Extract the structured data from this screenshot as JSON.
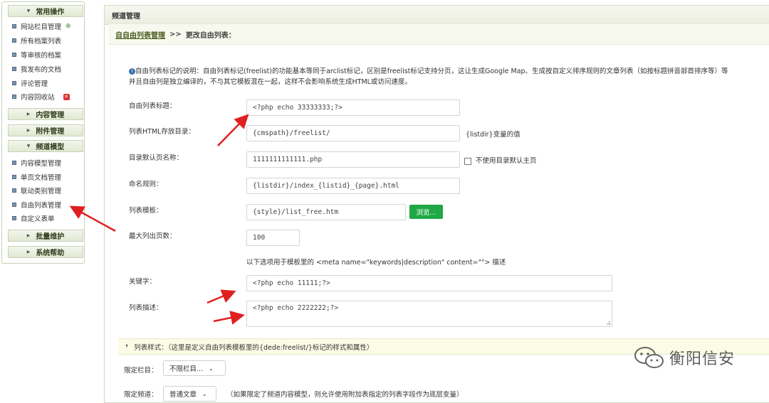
{
  "sidebar": {
    "sections": [
      {
        "label": "常用操作"
      },
      {
        "label": "内容管理"
      },
      {
        "label": "附件管理"
      },
      {
        "label": "频道模型"
      },
      {
        "label": "批量维护"
      },
      {
        "label": "系统帮助"
      }
    ],
    "common_items": [
      "网站栏目管理",
      "所有档案列表",
      "等审核的档案",
      "我发布的文档",
      "评论管理",
      "内容回收站"
    ],
    "channel_items": [
      "内容模型管理",
      "单页文档管理",
      "联动类别管理",
      "自由列表管理",
      "自定义表单"
    ]
  },
  "main": {
    "title": "频道管理",
    "breadcrumb": {
      "link": "自自由列表管理",
      "sep": ">>",
      "current": "更改自由列表："
    },
    "intro_line1": "自由列表标记的说明：自由列表标记(freelist)的功能基本等同于arclist标记，区别是freelist标记支持分页，这让生成Google Map、生成按自定义排序规则的文章列表（如按标题拼音部首排序等）等",
    "intro_line2": "并且自由列是独立编译的，不与其它模板混在一起，这样不会影响系统生成HTML或访问速度。",
    "form": {
      "title_label": "自由列表标题：",
      "title_value": "<?php echo 33333333;?>",
      "dir_label": "列表HTML存放目录：",
      "dir_value": "{cmspath}/freelist/",
      "dir_hint": "{listdir}变量的值",
      "default_label": "目录默认页名称：",
      "default_value": "1111111111111.php",
      "default_check": "不使用目录默认主页",
      "naming_label": "命名规则：",
      "naming_value": "{listdir}/index_{listid}_{page}.html",
      "template_label": "列表模板：",
      "template_value": "{style}/list_free.htm",
      "browse_label": "浏览...",
      "maxpages_label": "最大列出页数：",
      "maxpages_value": "100",
      "meta_note": "以下选项用于模板里的 <meta name=\"keywords|description\" content=\"\"> 描述",
      "keywords_label": "关键字：",
      "keywords_value": "<?php echo 11111;?>",
      "desc_label": "列表描述：",
      "desc_value": "<?php echo 2222222;?>"
    },
    "style_bar": "列表样式：（这里是定义自由列表模板里的{dede:freelist/}标记的样式和属性）",
    "category_label": "限定栏目：",
    "category_value": "不限栏目...",
    "channel_label": "限定频道：",
    "channel_value": "普通文章",
    "channel_note": "（如果限定了频道内容模型，则允许使用附加表指定的列表字段作为底层变量）"
  },
  "watermark": "衡阳信安",
  "colors": {
    "arrow": "#e02020",
    "green_button": "#1fa845"
  }
}
